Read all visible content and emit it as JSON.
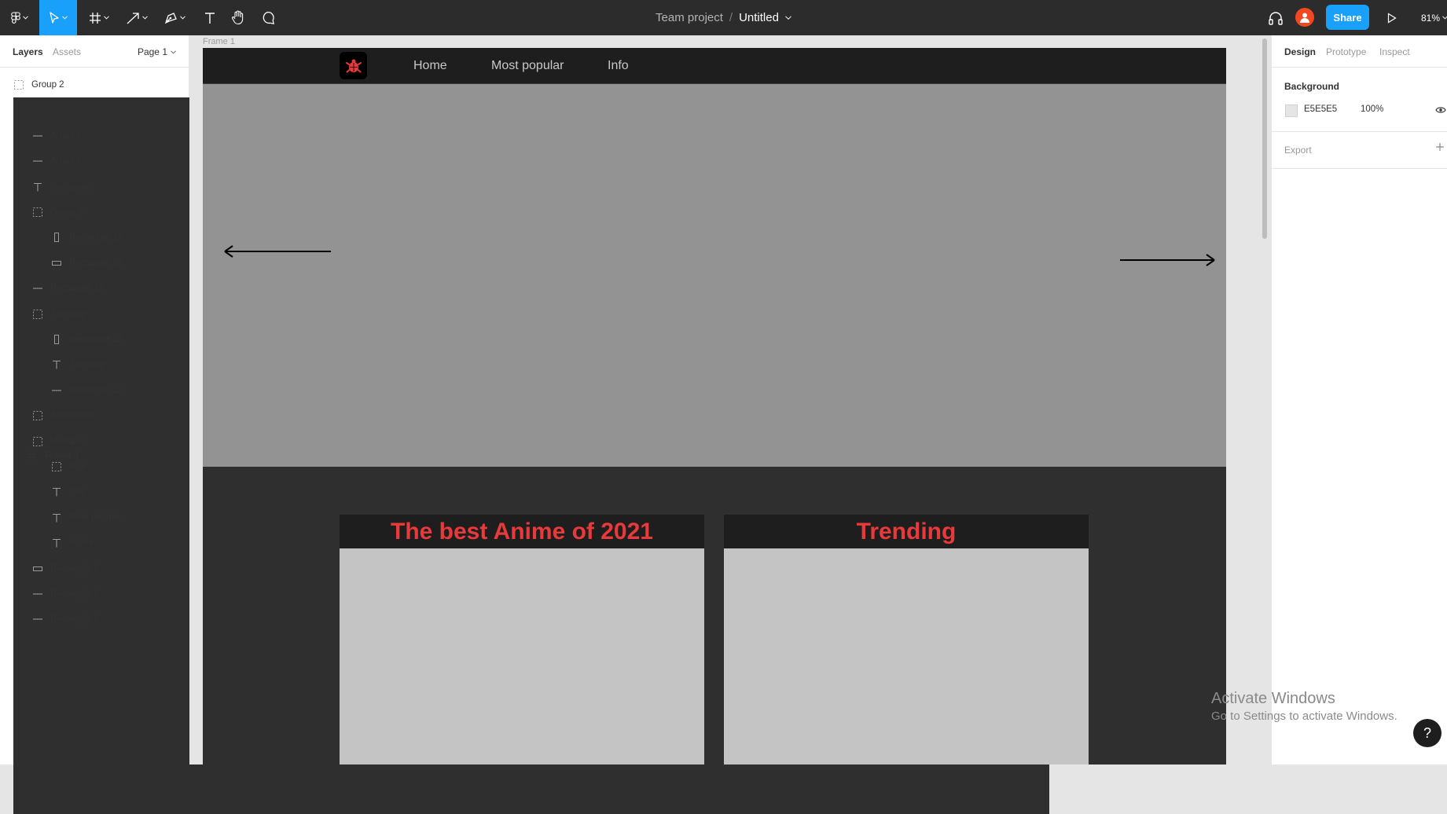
{
  "toolbar": {
    "project": "Team project",
    "separator": "/",
    "file_name": "Untitled",
    "share_label": "Share",
    "zoom": "81%",
    "tools": [
      "figma-menu-icon",
      "move-tool-icon",
      "frame-tool-icon",
      "arrow-tool-icon",
      "pen-tool-icon",
      "text-tool-icon",
      "hand-tool-icon",
      "comment-tool-icon"
    ]
  },
  "left_panel": {
    "tabs": [
      "Layers",
      "Assets"
    ],
    "page": "Page 1",
    "layers": [
      {
        "name": "Group 2",
        "icon": "group-icon",
        "indent": 0
      },
      {
        "name": "Frame 1",
        "icon": "frame-icon",
        "indent": 0
      },
      {
        "name": "Arrow 2",
        "icon": "line-icon",
        "indent": 1
      },
      {
        "name": "Arrow 1",
        "icon": "line-icon",
        "indent": 1
      },
      {
        "name": "Completed",
        "icon": "text-icon",
        "indent": 1
      },
      {
        "name": "Group 2",
        "icon": "group-icon",
        "indent": 1
      },
      {
        "name": "Rectangle 14",
        "icon": "rect-tall-icon",
        "indent": 2
      },
      {
        "name": "Rectangle 16",
        "icon": "rect-wide-icon",
        "indent": 2
      },
      {
        "name": "Rectangle 12",
        "icon": "line-icon",
        "indent": 1
      },
      {
        "name": "Trending",
        "icon": "group-icon",
        "indent": 1
      },
      {
        "name": "Rectangle 13",
        "icon": "rect-tall-icon",
        "indent": 2
      },
      {
        "name": "Trending",
        "icon": "text-icon",
        "indent": 2
      },
      {
        "name": "Rectangle 12",
        "icon": "line-icon",
        "indent": 2
      },
      {
        "name": "BestAnime",
        "icon": "group-icon",
        "indent": 1
      },
      {
        "name": "Headbar",
        "icon": "group-icon",
        "indent": 1
      },
      {
        "name": "logo",
        "icon": "group-icon",
        "indent": 2
      },
      {
        "name": "Info",
        "icon": "text-icon",
        "indent": 2
      },
      {
        "name": "Most popular",
        "icon": "text-icon",
        "indent": 2
      },
      {
        "name": "Home",
        "icon": "text-icon",
        "indent": 2
      },
      {
        "name": "Rectangle 1",
        "icon": "rect-wide-icon",
        "indent": 1
      },
      {
        "name": "Rectangle 2",
        "icon": "line-icon",
        "indent": 1
      },
      {
        "name": "Rectangle 6",
        "icon": "line-icon",
        "indent": 1
      }
    ]
  },
  "canvas": {
    "frame_label": "Frame 1",
    "nav": [
      "Home",
      "Most popular",
      "Info"
    ],
    "card_titles": [
      "The best Anime of 2021",
      "Trending"
    ]
  },
  "right_panel": {
    "tabs": [
      "Design",
      "Prototype",
      "Inspect"
    ],
    "background_title": "Background",
    "background_hex": "E5E5E5",
    "background_opacity": "100%",
    "export_title": "Export"
  },
  "overlay": {
    "activate_title": "Activate Windows",
    "activate_sub": "Go to Settings to activate Windows.",
    "help": "?"
  },
  "colors": {
    "accent": "#18a0fb",
    "toolbar": "#2c2c2c",
    "card_title": "#e83a3a"
  }
}
